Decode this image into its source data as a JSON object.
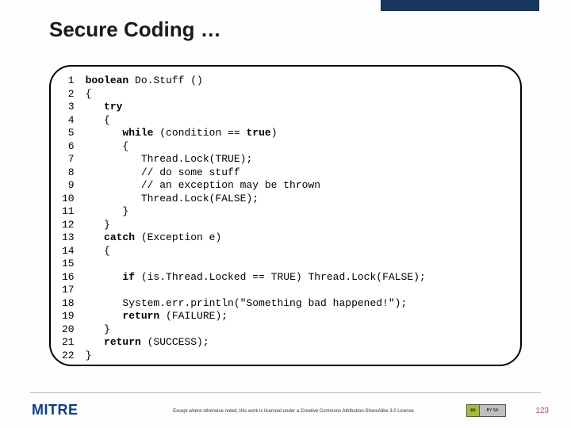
{
  "slide": {
    "title": "Secure Coding …",
    "code": {
      "line_numbers": [
        "1",
        "2",
        "3",
        "4",
        "5",
        "6",
        "7",
        "8",
        "9",
        "10",
        "11",
        "12",
        "13",
        "14",
        "15",
        "16",
        "17",
        "18",
        "19",
        "20",
        "21",
        "22"
      ],
      "lines": [
        [
          {
            "t": "boolean",
            "k": true
          },
          {
            "t": " Do.Stuff ()"
          }
        ],
        [
          {
            "t": "{"
          }
        ],
        [
          {
            "t": "   "
          },
          {
            "t": "try",
            "k": true
          }
        ],
        [
          {
            "t": "   {"
          }
        ],
        [
          {
            "t": "      "
          },
          {
            "t": "while",
            "k": true
          },
          {
            "t": " (condition == "
          },
          {
            "t": "true",
            "k": true
          },
          {
            "t": ")"
          }
        ],
        [
          {
            "t": "      {"
          }
        ],
        [
          {
            "t": "         Thread.Lock(TRUE);"
          }
        ],
        [
          {
            "t": "         // do some stuff"
          }
        ],
        [
          {
            "t": "         // an exception may be thrown"
          }
        ],
        [
          {
            "t": "         Thread.Lock(FALSE);"
          }
        ],
        [
          {
            "t": "      }"
          }
        ],
        [
          {
            "t": "   }"
          }
        ],
        [
          {
            "t": "   "
          },
          {
            "t": "catch",
            "k": true
          },
          {
            "t": " (Exception e)"
          }
        ],
        [
          {
            "t": "   {"
          }
        ],
        [
          {
            "t": ""
          }
        ],
        [
          {
            "t": "      "
          },
          {
            "t": "if",
            "k": true
          },
          {
            "t": " (is.Thread.Locked == TRUE) Thread.Lock(FALSE);"
          }
        ],
        [
          {
            "t": ""
          }
        ],
        [
          {
            "t": "      System.err.println(\"Something bad happened!\");"
          }
        ],
        [
          {
            "t": "      "
          },
          {
            "t": "return",
            "k": true
          },
          {
            "t": " (FAILURE);"
          }
        ],
        [
          {
            "t": "   }"
          }
        ],
        [
          {
            "t": "   "
          },
          {
            "t": "return",
            "k": true
          },
          {
            "t": " (SUCCESS);"
          }
        ],
        [
          {
            "t": "}"
          }
        ]
      ]
    }
  },
  "footer": {
    "logo": "MITRE",
    "license": "Except where otherwise noted, this work is licensed under a Creative Commons Attribution-ShareAlike 3.0 License",
    "cc_left": "cc",
    "cc_right": "BY SA",
    "page": "123"
  },
  "colors": {
    "accent": "#16365c",
    "logo": "#0b3c8c",
    "page_num": "#c0504d"
  }
}
